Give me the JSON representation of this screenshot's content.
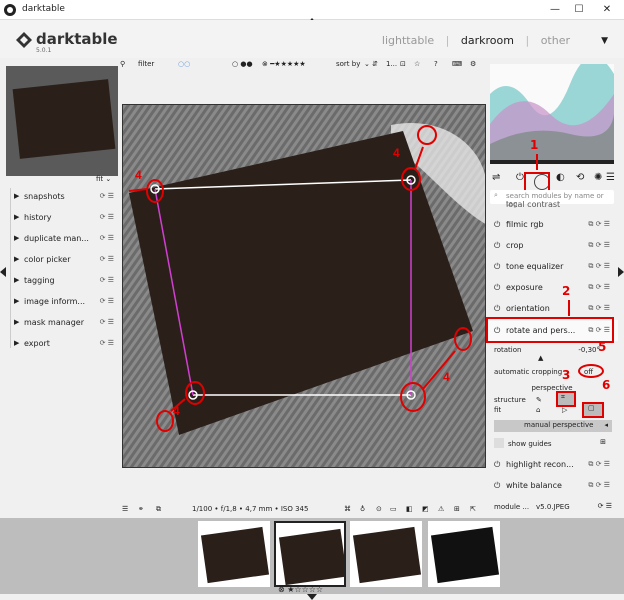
{
  "window": {
    "title": "darktable",
    "controls": [
      "minimize",
      "maximize",
      "close"
    ]
  },
  "app": {
    "brand": "darktable",
    "version": "5.0.1"
  },
  "views": {
    "items": [
      "lighttable",
      "darkroom",
      "other"
    ],
    "active": "darkroom",
    "sep": "|"
  },
  "left_panel": {
    "fit_label": "fit",
    "modules": [
      {
        "label": "snapshots"
      },
      {
        "label": "history"
      },
      {
        "label": "duplicate man..."
      },
      {
        "label": "color picker"
      },
      {
        "label": "tagging"
      },
      {
        "label": "image inform..."
      },
      {
        "label": "mask manager"
      },
      {
        "label": "export"
      }
    ]
  },
  "toolbar": {
    "filter_label": "filter",
    "sort_label": "sort by",
    "count_label": "1..."
  },
  "image_info": "1/100 • f/1,8 • 4,7 mm • ISO 345",
  "right_panel": {
    "search_placeholder": "search modules by name or tag",
    "partial_module": "local contrast",
    "modules": [
      {
        "label": "filmic rgb"
      },
      {
        "label": "crop"
      },
      {
        "label": "tone equalizer"
      },
      {
        "label": "exposure"
      },
      {
        "label": "orientation"
      },
      {
        "label": "rotate and pers..."
      }
    ],
    "rotation_label": "rotation",
    "rotation_value": "-0,30°",
    "auto_crop_label": "automatic cropping",
    "auto_crop_value": "off",
    "perspective_label": "perspective",
    "structure_label": "structure",
    "fit_label": "fit",
    "manual_perspective_label": "manual perspective",
    "show_guides_label": "show guides",
    "modules_after": [
      {
        "label": "highlight recon..."
      },
      {
        "label": "white balance"
      }
    ],
    "bottom_label": "module ...",
    "bottom_right": "v5.0.JPEG"
  },
  "annotations": [
    "1",
    "2",
    "3",
    "4",
    "4",
    "4",
    "4",
    "5",
    "6"
  ],
  "colors": {
    "annotation": "#e00000",
    "background": "#f0f0f0",
    "photo_bg": "#2b1f1a",
    "guides": "#d040d0"
  }
}
